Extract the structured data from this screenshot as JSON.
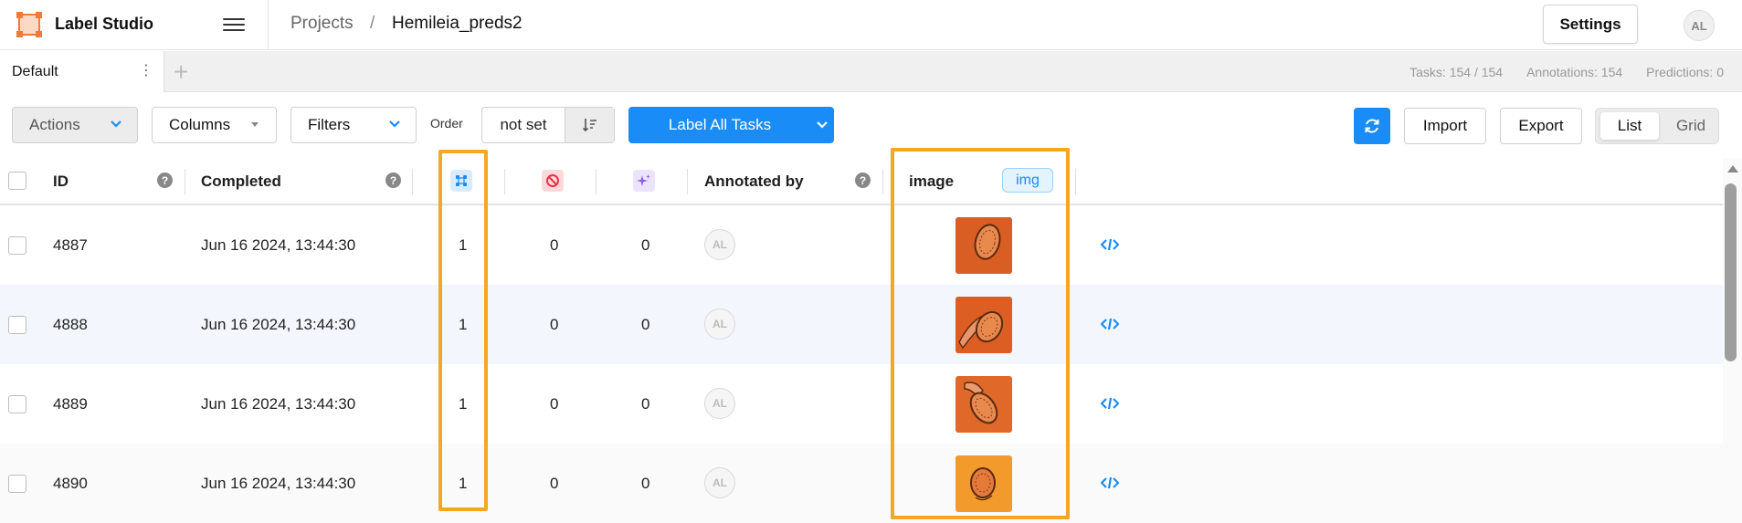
{
  "app": {
    "name": "Label Studio"
  },
  "breadcrumb": {
    "projects": "Projects",
    "separator": "/",
    "project": "Hemileia_preds2"
  },
  "header": {
    "settings_label": "Settings",
    "avatar_initials": "AL"
  },
  "tabs": [
    {
      "label": "Default",
      "menu_glyph": "⋮"
    }
  ],
  "tab_add_glyph": "+",
  "stats": {
    "tasks": "Tasks: 154 / 154",
    "annotations": "Annotations: 154",
    "predictions": "Predictions: 0"
  },
  "toolbar": {
    "actions_label": "Actions",
    "columns_label": "Columns",
    "filters_label": "Filters",
    "order_label": "Order",
    "order_value": "not set",
    "label_all_label": "Label All Tasks",
    "import_label": "Import",
    "export_label": "Export",
    "view_list_label": "List",
    "view_grid_label": "Grid"
  },
  "columns": {
    "id": "ID",
    "completed": "Completed",
    "annotated_by": "Annotated by",
    "image": "image",
    "image_type_badge": "img",
    "help_glyph": "?"
  },
  "rows": [
    {
      "id": "4887",
      "completed": "Jun 16 2024, 13:44:30",
      "annotations": "1",
      "cancelled": "0",
      "predictions": "0",
      "annotator": "AL"
    },
    {
      "id": "4888",
      "completed": "Jun 16 2024, 13:44:30",
      "annotations": "1",
      "cancelled": "0",
      "predictions": "0",
      "annotator": "AL"
    },
    {
      "id": "4889",
      "completed": "Jun 16 2024, 13:44:30",
      "annotations": "1",
      "cancelled": "0",
      "predictions": "0",
      "annotator": "AL"
    },
    {
      "id": "4890",
      "completed": "Jun 16 2024, 13:44:30",
      "annotations": "1",
      "cancelled": "0",
      "predictions": "0",
      "annotator": "AL"
    }
  ],
  "colors": {
    "accent": "#1a8cf7",
    "highlight": "#f5a623",
    "logo": "#f07a3a",
    "thumb": "#e0662a"
  },
  "icons": {
    "logo": "label-studio-logo-icon",
    "menu": "hamburger-icon",
    "order_direction": "sort-icon",
    "refresh": "refresh-icon",
    "annotations_column": "annotations-icon",
    "cancelled_column": "cancelled-icon",
    "predictions_column": "predictions-icon",
    "source": "code-icon"
  }
}
